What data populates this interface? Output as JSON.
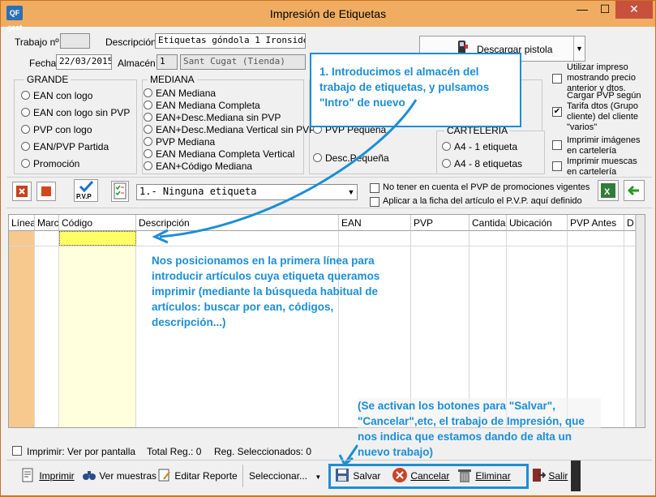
{
  "app_icon": "QF gest",
  "window": {
    "title": "Impresión de Etiquetas",
    "min": "—",
    "max": "☐",
    "close": "✕"
  },
  "header": {
    "trabajo_label": "Trabajo nº",
    "trabajo_value": "",
    "descripcion_label": "Descripción",
    "descripcion_value": "Etiquetas góndola 1 Ironside",
    "fecha_label": "Fecha",
    "fecha_value": "22/03/2015",
    "almacen_label": "Almacén",
    "almacen_code": "1",
    "almacen_name": "Sant Cugat (Tienda)",
    "descargar_label": "Descargar pistola"
  },
  "options": {
    "utilizar_impreso": "Utilizar impreso mostrando precio anterior y dtos.",
    "cargar_pvp": "Cargar PVP según Tarifa dtos (Grupo cliente) del cliente \"varios\"",
    "imprimir_imagenes": "Imprimir imágenes en cartelería",
    "imprimir_muescas": "Imprimir muescas en cartelería"
  },
  "grande": {
    "title": "GRANDE",
    "items": [
      "EAN con logo",
      "EAN con logo sin PVP",
      "PVP con logo",
      "EAN/PVP Partida",
      "Promoción"
    ]
  },
  "mediana": {
    "title": "MEDIANA",
    "items": [
      "EAN Mediana",
      "EAN Mediana Completa",
      "EAN+Desc.Mediana sin PVP",
      "EAN+Desc.Mediana Vertical sin PVP",
      "PVP Mediana",
      "EAN Mediana Completa Vertical",
      "EAN+Código Mediana"
    ]
  },
  "pequena": {
    "items": [
      "PVP Pequeña",
      "Desc.Pequeña"
    ]
  },
  "carteleria": {
    "title": "CARTELERÍA",
    "items": [
      "A4 - 1 etiqueta",
      "A4 - 8 etiquetas"
    ]
  },
  "toolbar": {
    "pvp_label": "P.V.P",
    "etiqueta_select": "1.- Ninguna etiqueta",
    "no_tener_en_cuenta": "No tener en cuenta el PVP de promociones vigentes",
    "aplicar_ficha": "Aplicar a la ficha del artículo el P.V.P. aquí definido"
  },
  "grid": {
    "columns": [
      "Línea",
      "Marca",
      "Código",
      "Descripción",
      "EAN",
      "PVP",
      "Cantidad",
      "Ubicación",
      "PVP Antes",
      "D"
    ]
  },
  "status": {
    "imprimir_pantalla": "Imprimir: Ver por pantalla",
    "total_reg": "Total Reg.: 0",
    "reg_seleccionados": "Reg. Seleccionados: 0"
  },
  "footer": {
    "imprimir": "Imprimir",
    "ver_muestras": "Ver muestras",
    "editar_reporte": "Editar Reporte",
    "seleccionar": "Seleccionar...",
    "salvar": "Salvar",
    "cancelar": "Cancelar",
    "eliminar": "Eliminar",
    "salir": "Salir"
  },
  "annotations": {
    "note1": "1. Introducimos el almacén del trabajo de etiquetas, y pulsamos \"Intro\" de nuevo",
    "note2": "Nos posicionamos en la primera línea para introducir artículos cuya etiqueta queramos imprimir (mediante la búsqueda habitual de artículos: buscar por ean, códigos, descripción...)",
    "note3": "(Se activan los botones para \"Salvar\", \"Cancelar\",etc, el trabajo de Impresión, que nos indica que estamos dando de alta un nuevo trabajo)"
  },
  "colors": {
    "titlebar": "#f0ad62",
    "annotation": "#1b8ed6",
    "selected_cell": "#ffff99",
    "line_column": "#f7c98e"
  }
}
